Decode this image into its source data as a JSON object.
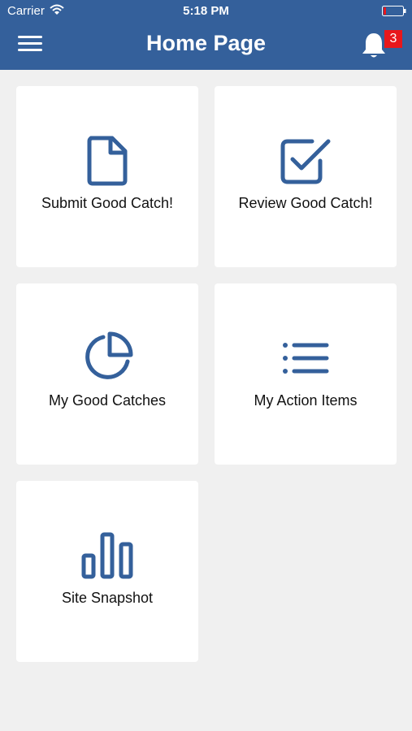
{
  "status_bar": {
    "carrier": "Carrier",
    "time": "5:18 PM",
    "wifi_icon": "wifi-icon",
    "battery_icon": "battery-low-icon"
  },
  "header": {
    "title": "Home Page",
    "menu_icon": "hamburger-menu-icon",
    "notification_icon": "bell-icon",
    "notification_count": "3",
    "background_color": "#34609b",
    "badge_color": "#e8171b"
  },
  "tiles": [
    {
      "label": "Submit Good Catch!",
      "icon": "document-icon"
    },
    {
      "label": "Review Good Catch!",
      "icon": "checkbox-checked-icon"
    },
    {
      "label": "My Good Catches",
      "icon": "pie-chart-icon"
    },
    {
      "label": "My Action Items",
      "icon": "list-icon"
    },
    {
      "label": "Site Snapshot",
      "icon": "bar-chart-icon"
    }
  ],
  "colors": {
    "icon_color": "#34609b",
    "page_background": "#f0f0f0",
    "tile_background": "#ffffff"
  }
}
